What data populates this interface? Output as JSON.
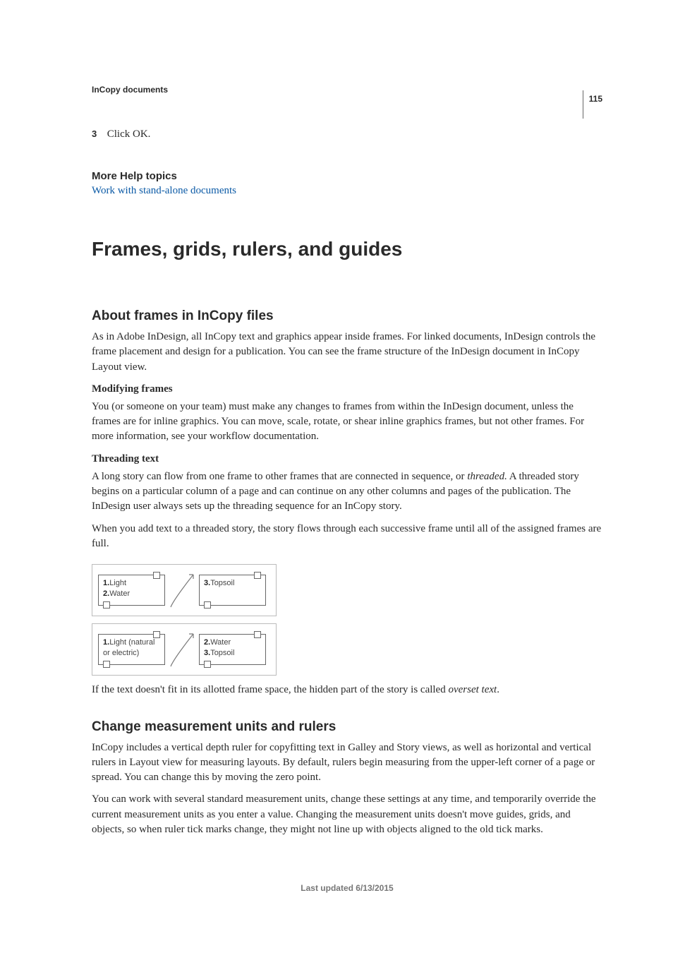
{
  "page_number": "115",
  "chapter": "InCopy documents",
  "step": {
    "number": "3",
    "text": "Click OK."
  },
  "help": {
    "heading": "More Help topics",
    "link_text": "Work with stand-alone documents"
  },
  "h1": "Frames, grids, rulers, and guides",
  "sec1": {
    "title": "About frames in InCopy files",
    "p1": "As in Adobe InDesign, all InCopy text and graphics appear inside frames. For linked documents, InDesign controls the frame placement and design for a publication. You can see the frame structure of the InDesign document in InCopy Layout view.",
    "sub1": "Modifying frames",
    "p2": "You (or someone on your team) must make any changes to frames from within the InDesign document, unless the frames are for inline graphics. You can move, scale, rotate, or shear inline graphics frames, but not other frames. For more information, see your workflow documentation.",
    "sub2": "Threading text",
    "p3a": "A long story can flow from one frame to other frames that are connected in sequence, or ",
    "p3_em": "threaded.",
    "p3b": " A threaded story begins on a particular column of a page and can continue on any other columns and pages of the publication. The InDesign user always sets up the threading sequence for an InCopy story.",
    "p4": "When you add text to a threaded story, the story flows through each successive frame until all of the assigned frames are full.",
    "fig": {
      "row1": {
        "f1_l1_b": "1.",
        "f1_l1": "Light",
        "f1_l2_b": "2.",
        "f1_l2": "Water",
        "f2_l1_b": "3.",
        "f2_l1": "Topsoil"
      },
      "row2": {
        "f1_l1_b": "1.",
        "f1_l1": "Light (natural or electric)",
        "f2_l1_b": "2.",
        "f2_l1": "Water",
        "f2_l2_b": "3.",
        "f2_l2": "Topsoil"
      }
    },
    "caption_a": "If the text doesn't fit in its allotted frame space, the hidden part of the story is called ",
    "caption_em": "overset text",
    "caption_b": "."
  },
  "sec2": {
    "title": "Change measurement units and rulers",
    "p1": "InCopy includes a vertical depth ruler for copyfitting text in Galley and Story views, as well as horizontal and vertical rulers in Layout view for measuring layouts. By default, rulers begin measuring from the upper-left corner of a page or spread. You can change this by moving the zero point.",
    "p2": "You can work with several standard measurement units, change these settings at any time, and temporarily override the current measurement units as you enter a value. Changing the measurement units doesn't move guides, grids, and objects, so when ruler tick marks change, they might not line up with objects aligned to the old tick marks."
  },
  "footer": "Last updated 6/13/2015"
}
